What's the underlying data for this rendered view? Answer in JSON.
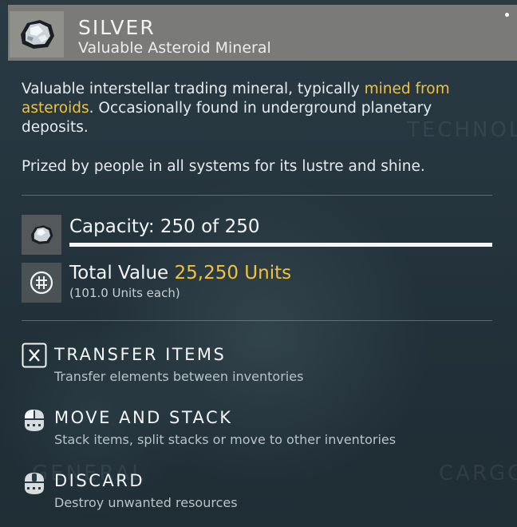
{
  "header": {
    "title": "SILVER",
    "subtitle": "Valuable Asteroid Mineral",
    "icon": "silver-mineral-icon"
  },
  "background_labels": {
    "technology": "TECHNOLO",
    "general": "GENERAL",
    "cargo": "CARGO"
  },
  "description": {
    "part1": "Valuable interstellar trading mineral, typically ",
    "highlight": "mined from asteroids",
    "part2": ". Occasionally found in underground planetary deposits.",
    "line2": "Prized by people in all systems for its lustre and shine."
  },
  "capacity": {
    "label": "Capacity: 250 of 250",
    "current": 250,
    "max": 250,
    "fill_fraction": 1.0
  },
  "value": {
    "label": "Total Value ",
    "amount": "25,250 Units",
    "each": "(101.0 Units each)",
    "icon": "units-currency-icon"
  },
  "actions": [
    {
      "title": "TRANSFER ITEMS",
      "subtitle": "Transfer elements between inventories",
      "icon": "x-key-icon"
    },
    {
      "title": "MOVE AND STACK",
      "subtitle": "Stack items, split stacks or move to other inventories",
      "icon": "left-mouse-icon"
    },
    {
      "title": "DISCARD",
      "subtitle": "Destroy unwanted resources",
      "icon": "middle-mouse-icon"
    }
  ],
  "colors": {
    "highlight": "#f2c23c",
    "header_bg": "#7a7b78",
    "panel_bg": "#24343d"
  }
}
